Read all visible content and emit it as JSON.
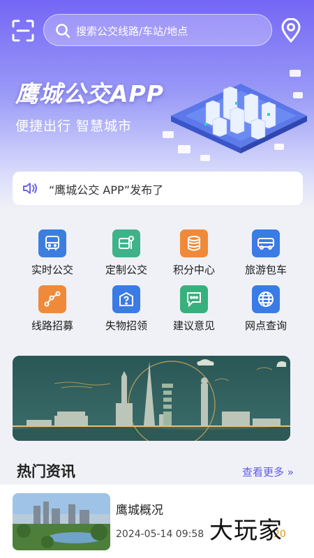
{
  "search": {
    "placeholder": "搜索公交线路/车站/地点"
  },
  "hero": {
    "title": "鹰城公交APP",
    "subtitle": "便捷出行 智慧城市"
  },
  "notice": {
    "text": "“鹰城公交 APP”发布了"
  },
  "grid": [
    {
      "label": "实时公交",
      "icon": "bus-icon",
      "color": "#3d7de0"
    },
    {
      "label": "定制公交",
      "icon": "custom-bus-icon",
      "color": "#3fb28a"
    },
    {
      "label": "积分中心",
      "icon": "coins-icon",
      "color": "#ef8a3a"
    },
    {
      "label": "旅游包车",
      "icon": "coach-icon",
      "color": "#3a7be6"
    },
    {
      "label": "线路招募",
      "icon": "route-icon",
      "color": "#ef8a3a"
    },
    {
      "label": "失物招领",
      "icon": "lost-found-icon",
      "color": "#3a7be6"
    },
    {
      "label": "建议意见",
      "icon": "message-icon",
      "color": "#38b07e"
    },
    {
      "label": "网点查询",
      "icon": "globe-icon",
      "color": "#3a7be6"
    }
  ],
  "section": {
    "title": "热门资讯",
    "more": "查看更多 »"
  },
  "news": [
    {
      "title": "鹰城概况",
      "date": "2024-05-14 09:58",
      "count": "20"
    }
  ],
  "watermark": {
    "text": "大玩家"
  },
  "colors": {
    "primary": "#7466f5",
    "accent": "#5f59f0"
  }
}
